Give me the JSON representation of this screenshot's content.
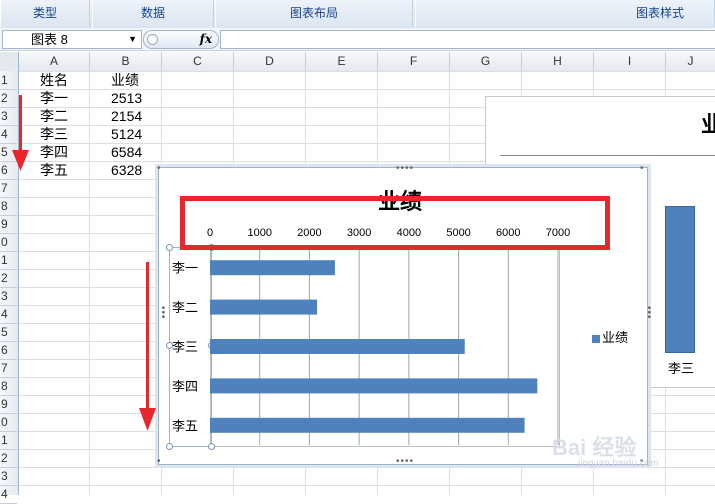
{
  "ribbon": {
    "groups": [
      "类型",
      "数据",
      "图表布局",
      "图表样式"
    ]
  },
  "formula_bar": {
    "name_box": "图表 8",
    "fx": "fx",
    "formula": ""
  },
  "columns": [
    "A",
    "B",
    "C",
    "D",
    "E",
    "F",
    "G",
    "H",
    "I",
    "J"
  ],
  "rows": [
    "1",
    "2",
    "3",
    "4",
    "5",
    "6",
    "7",
    "8",
    "9",
    "0",
    "1",
    "2",
    "3",
    "4",
    "5",
    "6",
    "7",
    "8",
    "9",
    "0",
    "1",
    "2",
    "3",
    "4"
  ],
  "cells": {
    "header": [
      "姓名",
      "业绩"
    ],
    "records": [
      {
        "name": "李一",
        "score": "2513"
      },
      {
        "name": "李二",
        "score": "2154"
      },
      {
        "name": "李三",
        "score": "5124"
      },
      {
        "name": "李四",
        "score": "6584"
      },
      {
        "name": "李五",
        "score": "6328"
      }
    ]
  },
  "background_chart": {
    "title": "业",
    "category": "李三"
  },
  "chart_data": {
    "type": "bar",
    "orientation": "horizontal",
    "title": "业绩",
    "categories": [
      "李一",
      "李二",
      "李三",
      "李四",
      "李五"
    ],
    "series": [
      {
        "name": "业绩",
        "values": [
          2513,
          2154,
          5124,
          6584,
          6328
        ]
      }
    ],
    "x_ticks": [
      "0",
      "1000",
      "2000",
      "3000",
      "4000",
      "5000",
      "6000",
      "7000"
    ],
    "xlim": [
      0,
      7000
    ],
    "axis_position": "top",
    "grid": true,
    "legend": "right",
    "color": "#4f81bd"
  },
  "annotations": {
    "box_color": "#e8262b",
    "arrow_color": "#e8262b"
  },
  "watermark": {
    "text": "Bai 经验",
    "sub": "jingyan.baidu.com"
  }
}
